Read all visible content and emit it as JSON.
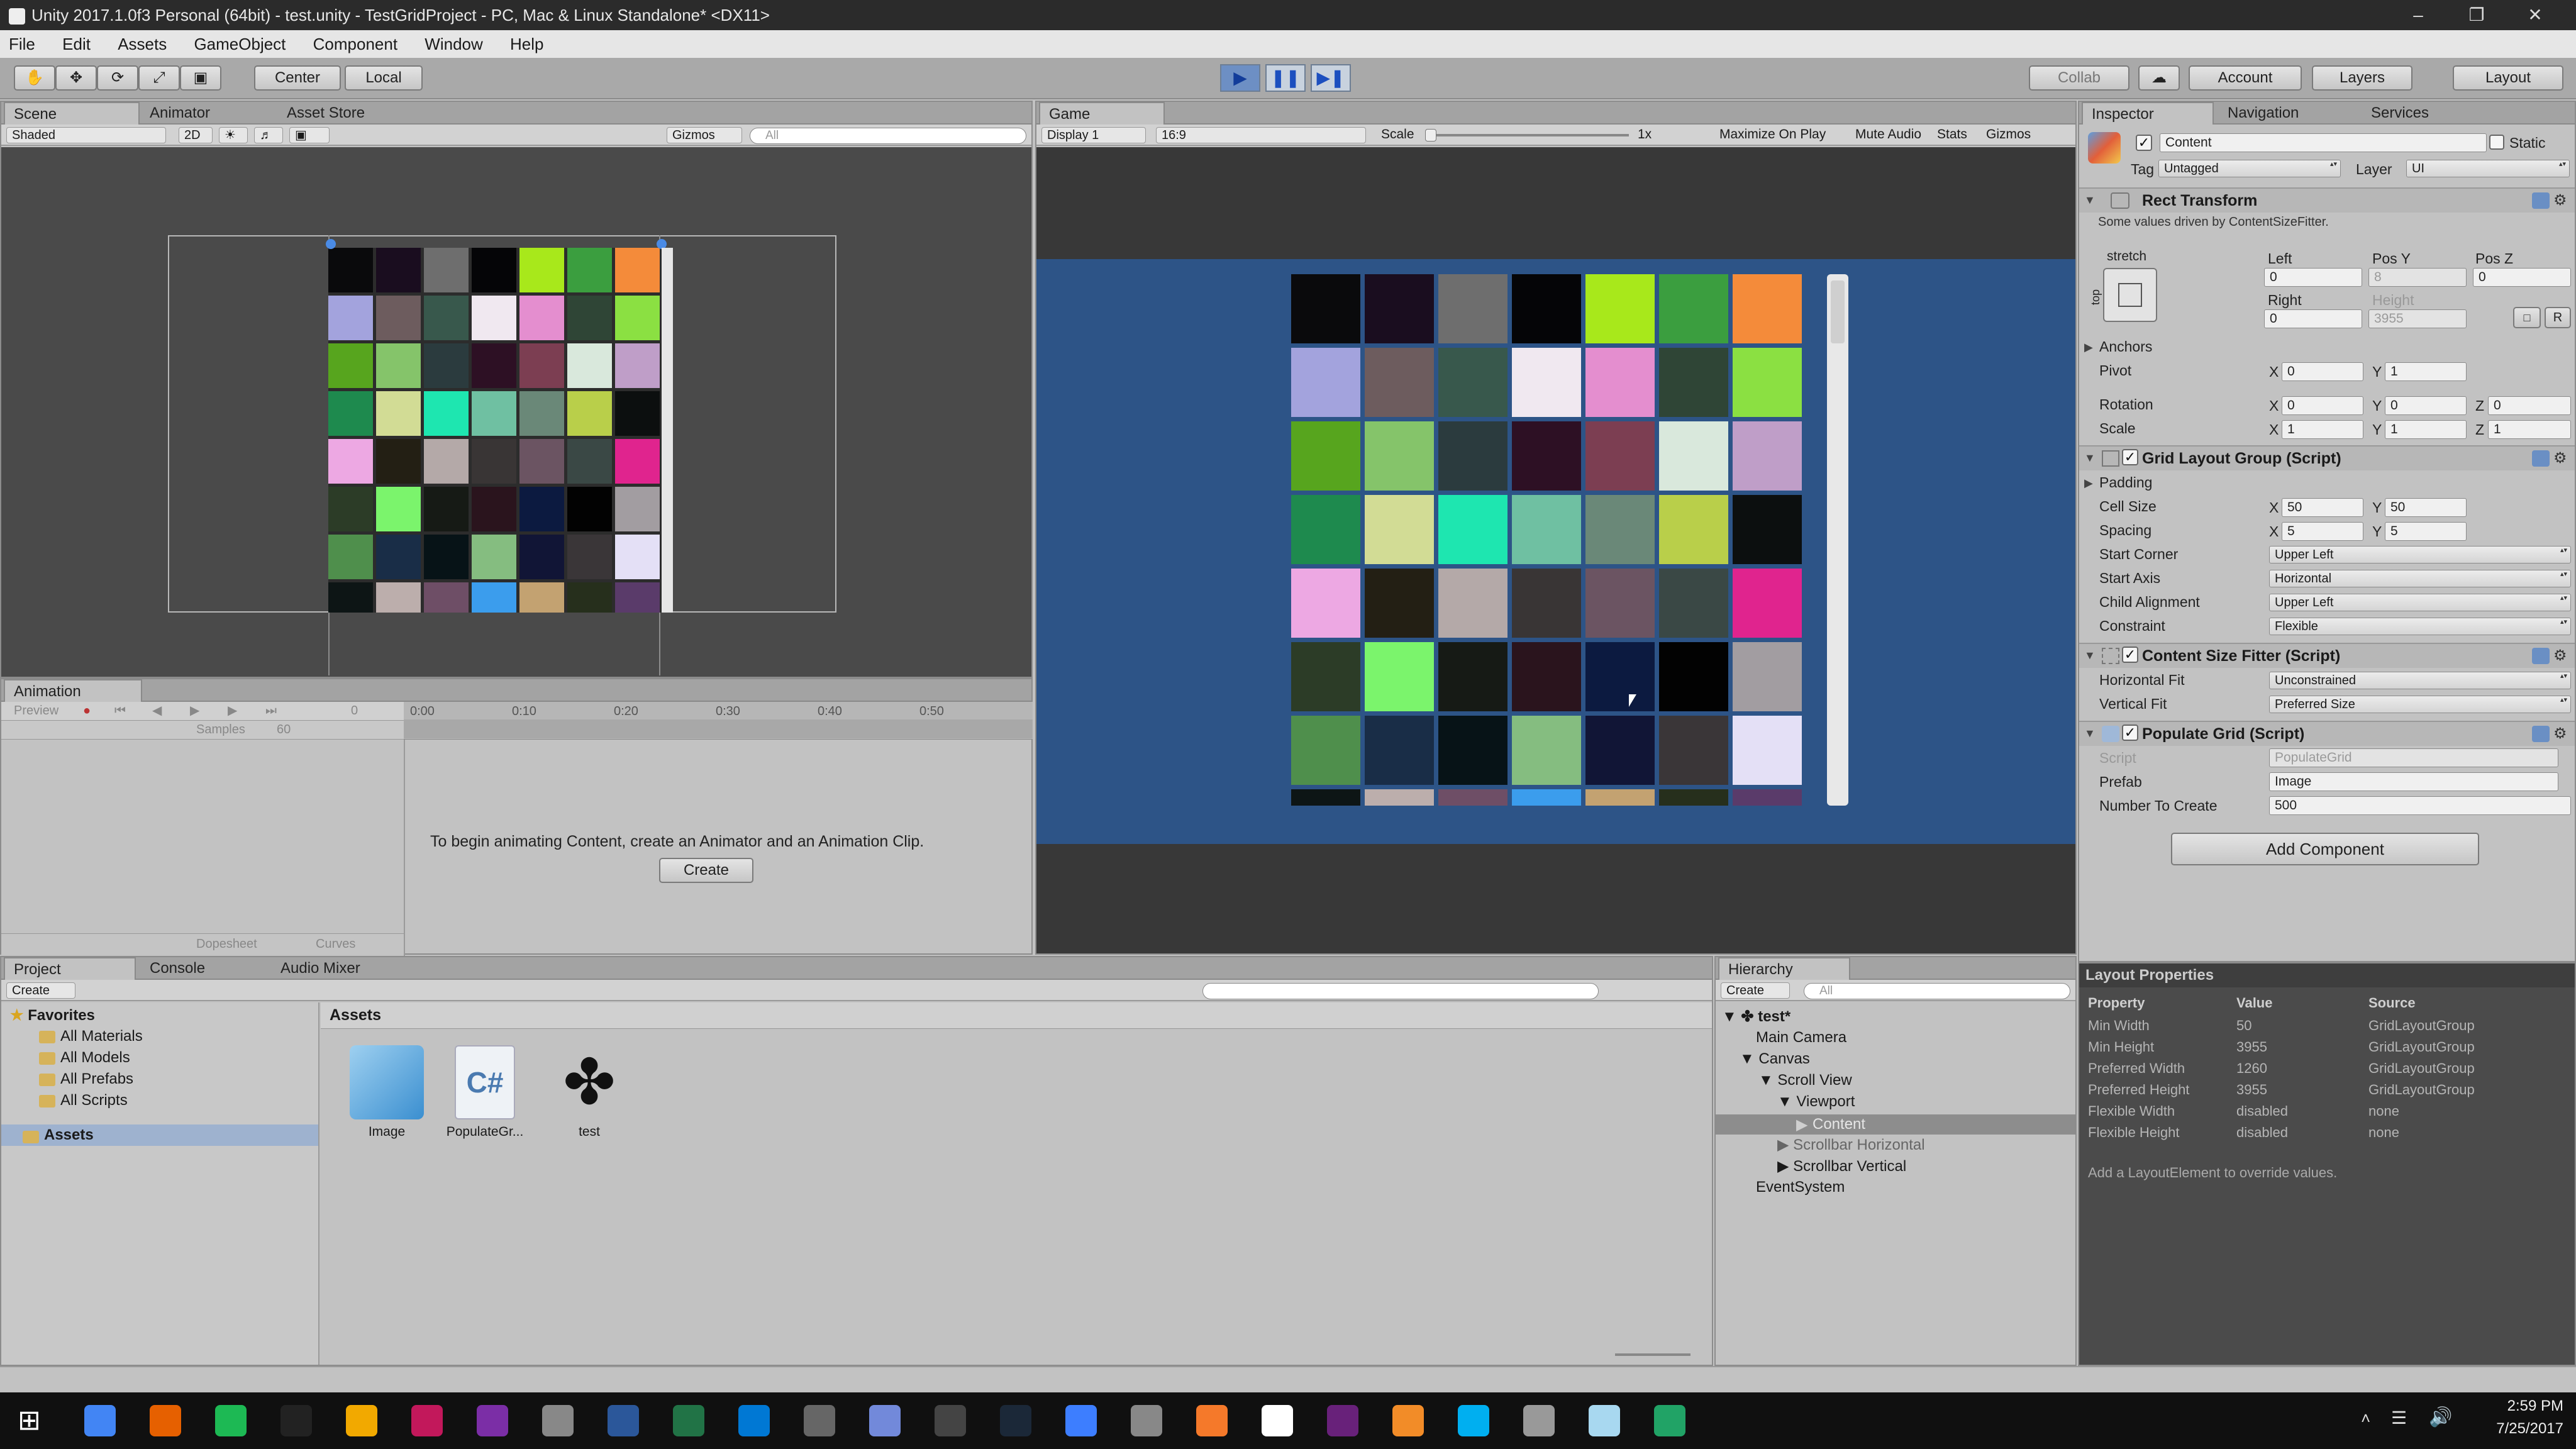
{
  "window": {
    "title": "Unity 2017.1.0f3 Personal (64bit) - test.unity - TestGridProject - PC, Mac & Linux Standalone* <DX11>",
    "minimize": "–",
    "maximize": "❐",
    "close": "✕"
  },
  "menu": [
    "File",
    "Edit",
    "Assets",
    "GameObject",
    "Component",
    "Window",
    "Help"
  ],
  "toolbar": {
    "pivot_center": "Center",
    "pivot_local": "Local",
    "play": "▶",
    "pause": "❚❚",
    "step": "▶❚",
    "collab": "Collab",
    "account": "Account",
    "layers": "Layers",
    "layout": "Layout"
  },
  "scene_panel": {
    "tabs": [
      "Scene",
      "Animator",
      "Asset Store"
    ],
    "shading": "Shaded",
    "mode_2d": "2D",
    "gizmos": "Gizmos",
    "search_placeholder": "All"
  },
  "game_panel": {
    "tab": "Game",
    "display": "Display 1",
    "aspect": "16:9",
    "scale_label": "Scale",
    "scale_value": "1x",
    "maximize": "Maximize On Play",
    "mute": "Mute Audio",
    "stats": "Stats",
    "gizmos": "Gizmos"
  },
  "grid_colors": [
    [
      "#0a0a0c",
      "#1a0d1f",
      "#6e6e6e",
      "#050507",
      "#a8e81b",
      "#3b9e3f",
      "#f48b3a"
    ],
    [
      "#a3a3dd",
      "#6d5c5e",
      "#38584c",
      "#f0e8f0",
      "#e48ecf",
      "#2f4536",
      "#8be042"
    ],
    [
      "#57a51e",
      "#85c46a",
      "#2b3b3e",
      "#2d1024",
      "#7c3e52",
      "#d9e8dc",
      "#bf9ec8"
    ],
    [
      "#1e8a4e",
      "#d2dc95",
      "#1ee6b0",
      "#6fc0a2",
      "#6a8878",
      "#b9cf4a",
      "#0c0f0f"
    ],
    [
      "#eda8e3",
      "#231f14",
      "#b4a9a8",
      "#393535",
      "#6b5462",
      "#3a4845",
      "#e0248e"
    ],
    [
      "#2c3c27",
      "#7bf46c",
      "#161a15",
      "#2a141d",
      "#0c1a40",
      "#020202",
      "#a29da1"
    ],
    [
      "#4f8f4c",
      "#192d47",
      "#071317",
      "#85bd80",
      "#111536",
      "#3a3638",
      "#e4e0f6"
    ],
    [
      "#0d1515",
      "#bcaeac",
      "#6e4e66",
      "#3b9ded",
      "#c3a271",
      "#262f1c",
      "#5a3b6a"
    ]
  ],
  "animation_panel": {
    "tab": "Animation",
    "preview": "Preview",
    "samples_label": "Samples",
    "samples_value": "60",
    "frame": "0",
    "times": [
      "0:00",
      "0:10",
      "0:20",
      "0:30",
      "0:40",
      "0:50"
    ],
    "message": "To begin animating Content, create an Animator and an Animation Clip.",
    "create": "Create",
    "dopesheet": "Dopesheet",
    "curves": "Curves"
  },
  "inspector": {
    "tabs": [
      "Inspector",
      "Navigation",
      "Services"
    ],
    "object_name": "Content",
    "static_label": "Static",
    "tag_label": "Tag",
    "tag_value": "Untagged",
    "layer_label": "Layer",
    "layer_value": "UI",
    "rect_transform": {
      "title": "Rect Transform",
      "note": "Some values driven by ContentSizeFitter.",
      "anchor_preset": "stretch",
      "side": "top",
      "left_label": "Left",
      "posy_label": "Pos Y",
      "posz_label": "Pos Z",
      "left": "0",
      "posy": "8",
      "posz": "0",
      "right_label": "Right",
      "height_label": "Height",
      "right": "0",
      "height": "3955",
      "reset": "R",
      "anchors": "Anchors",
      "pivot_label": "Pivot",
      "pivot_x": "0",
      "pivot_y": "1",
      "rotation_label": "Rotation",
      "rot_x": "0",
      "rot_y": "0",
      "rot_z": "0",
      "scale_label": "Scale",
      "scale_x": "1",
      "scale_y": "1",
      "scale_z": "1"
    },
    "grid_layout": {
      "title": "Grid Layout Group (Script)",
      "padding": "Padding",
      "cell_size_label": "Cell Size",
      "cell_x": "50",
      "cell_y": "50",
      "spacing_label": "Spacing",
      "spacing_x": "5",
      "spacing_y": "5",
      "start_corner_label": "Start Corner",
      "start_corner": "Upper Left",
      "start_axis_label": "Start Axis",
      "start_axis": "Horizontal",
      "child_align_label": "Child Alignment",
      "child_align": "Upper Left",
      "constraint_label": "Constraint",
      "constraint": "Flexible"
    },
    "content_fitter": {
      "title": "Content Size Fitter (Script)",
      "hfit_label": "Horizontal Fit",
      "hfit": "Unconstrained",
      "vfit_label": "Vertical Fit",
      "vfit": "Preferred Size"
    },
    "populate": {
      "title": "Populate Grid (Script)",
      "script_label": "Script",
      "script": "PopulateGrid",
      "prefab_label": "Prefab",
      "prefab": "Image",
      "number_label": "Number To Create",
      "number": "500"
    },
    "add_component": "Add Component",
    "axis_x": "X",
    "axis_y": "Y",
    "axis_z": "Z"
  },
  "layout_properties": {
    "title": "Layout Properties",
    "headers": [
      "Property",
      "Value",
      "Source"
    ],
    "rows": [
      [
        "Min Width",
        "50",
        "GridLayoutGroup"
      ],
      [
        "Min Height",
        "3955",
        "GridLayoutGroup"
      ],
      [
        "Preferred Width",
        "1260",
        "GridLayoutGroup"
      ],
      [
        "Preferred Height",
        "3955",
        "GridLayoutGroup"
      ],
      [
        "Flexible Width",
        "disabled",
        "none"
      ],
      [
        "Flexible Height",
        "disabled",
        "none"
      ]
    ],
    "note": "Add a LayoutElement to override values."
  },
  "project_panel": {
    "tabs": [
      "Project",
      "Console",
      "Audio Mixer"
    ],
    "create": "Create",
    "favorites": "Favorites",
    "fav_items": [
      "All Materials",
      "All Models",
      "All Prefabs",
      "All Scripts"
    ],
    "assets_root": "Assets",
    "assets_header": "Assets",
    "assets": [
      "Image",
      "PopulateGr...",
      "test"
    ]
  },
  "hierarchy": {
    "tab": "Hierarchy",
    "create": "Create",
    "search_placeholder": "All",
    "scene": "test*",
    "items": [
      "Main Camera",
      "Canvas",
      "Scroll View",
      "Viewport",
      "Content",
      "Scrollbar Horizontal",
      "Scrollbar Vertical",
      "EventSystem"
    ]
  },
  "taskbar": {
    "time": "2:59 PM",
    "date": "7/25/2017",
    "icon_colors": [
      "#4285f4",
      "#e66000",
      "#1db954",
      "#222222",
      "#f2a900",
      "#c2185b",
      "#7b2ea6",
      "#888888",
      "#2b579a",
      "#217346",
      "#0078d4",
      "#666666",
      "#7289da",
      "#444444",
      "#1b2838",
      "#3d7eff",
      "#888888",
      "#f5792a",
      "#ffffff",
      "#68217a",
      "#f28c28",
      "#00aff0",
      "#999999",
      "#a8d8f0",
      "#21a366"
    ]
  }
}
